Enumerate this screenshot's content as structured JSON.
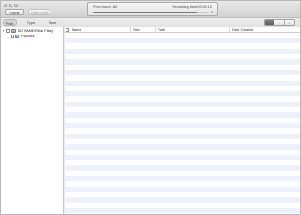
{
  "toolbar": {
    "home_label": "Home",
    "deep_scan_label": "Deep Scan"
  },
  "status": {
    "files_found": "Files found 180",
    "remaining_time": "Remaining time 00:00:12",
    "progress_fraction": 0.9
  },
  "tabs": {
    "path": "Path",
    "type": "Type",
    "time": "Time"
  },
  "view_modes": [
    "list-view",
    "icon-view",
    "column-view"
  ],
  "tree": {
    "root_label": "NO NAME(RAW Files)",
    "child_label": "Pictures"
  },
  "list": {
    "columns": {
      "name": "Name",
      "size": "Size",
      "path": "Path",
      "date": "Date Created"
    }
  }
}
